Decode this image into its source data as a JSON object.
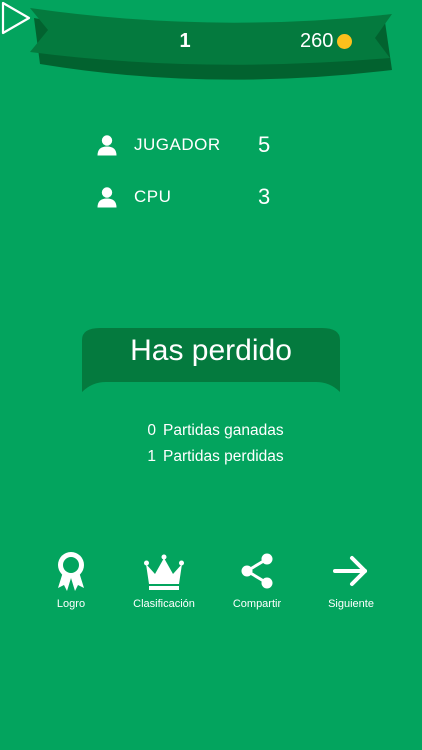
{
  "header": {
    "level": "1",
    "coins": "260"
  },
  "scores": [
    {
      "name": "JUGADOR",
      "score": "5"
    },
    {
      "name": "CPU",
      "score": "3"
    }
  ],
  "result": {
    "title": "Has perdido"
  },
  "stats": [
    {
      "value": "0",
      "label": "Partidas ganadas"
    },
    {
      "value": "1",
      "label": "Partidas perdidas"
    }
  ],
  "actions": [
    {
      "label": "Logro",
      "icon": "award-ribbon-icon"
    },
    {
      "label": "Clasificación",
      "icon": "crown-icon"
    },
    {
      "label": "Compartir",
      "icon": "share-icon"
    },
    {
      "label": "Siguiente",
      "icon": "arrow-right-icon"
    }
  ],
  "colors": {
    "background": "#03a45e",
    "banner": "#047a3e",
    "banner_shadow": "#02622f",
    "coin": "#fbc01c",
    "text": "#ffffff"
  }
}
